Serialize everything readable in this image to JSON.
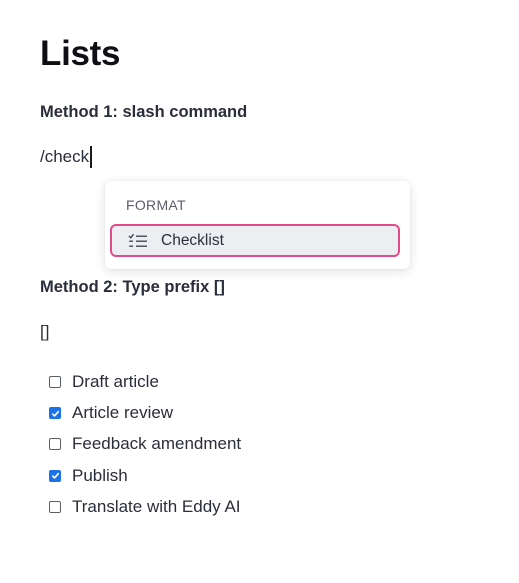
{
  "page": {
    "title": "Lists"
  },
  "method1": {
    "heading": "Method 1: slash command",
    "typed_text": "/check"
  },
  "dropdown": {
    "section_label": "FORMAT",
    "items": [
      {
        "label": "Checklist",
        "icon": "checklist-icon",
        "highlighted": true
      }
    ],
    "highlight_color": "#e24a8b"
  },
  "method2": {
    "heading": "Method 2: Type prefix []",
    "typed_text": "[]"
  },
  "checklist": {
    "items": [
      {
        "label": "Draft article",
        "checked": false
      },
      {
        "label": "Article review",
        "checked": true
      },
      {
        "label": "Feedback amendment",
        "checked": false
      },
      {
        "label": "Publish",
        "checked": true
      },
      {
        "label": "Translate with Eddy AI",
        "checked": false
      }
    ],
    "checked_color": "#1a73e8"
  }
}
